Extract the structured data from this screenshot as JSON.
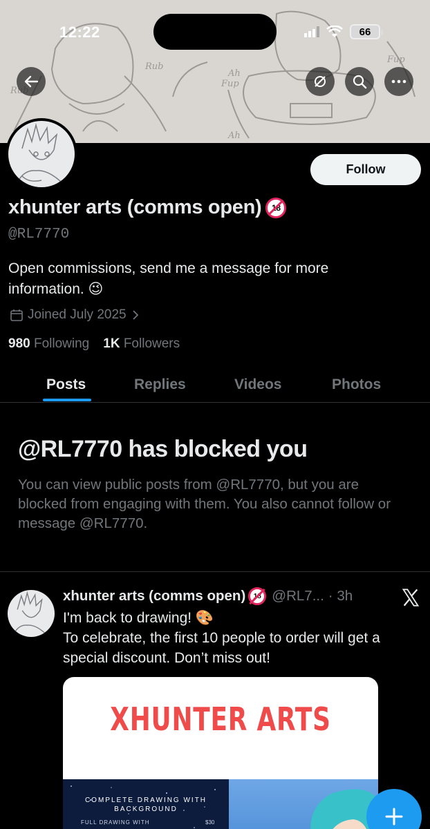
{
  "status_bar": {
    "time": "12:22",
    "battery": "66"
  },
  "profile": {
    "display_name": "xhunter arts (comms open)",
    "handle": "@RL7770",
    "bio": "Open commissions, send me a message for more information. 😉",
    "joined": "Joined July 2025",
    "following_count": "980",
    "following_label": "Following",
    "followers_count": "1K",
    "followers_label": "Followers",
    "follow_button": "Follow"
  },
  "tabs": [
    {
      "label": "Posts",
      "active": true
    },
    {
      "label": "Replies",
      "active": false
    },
    {
      "label": "Videos",
      "active": false
    },
    {
      "label": "Photos",
      "active": false
    }
  ],
  "blocked": {
    "title": "@RL7770 has blocked you",
    "message": "You can view public posts from @RL7770, but you are blocked from engaging with them. You also cannot follow or message @RL7770."
  },
  "post": {
    "author": "xhunter arts (comms open)",
    "handle_trunc": "@RL7...",
    "time": "· 3h",
    "line1": "I'm back to drawing! 🎨",
    "line2": "To celebrate, the first 10 people to order will get a special discount. Don’t miss out!",
    "media": {
      "title": "XHUNTER ARTS",
      "card_heading": "COMPLETE DRAWING WITH BACKGROUND",
      "card_item": "FULL DRAWING WITH",
      "card_price": "$30"
    }
  },
  "icons": {
    "back": "arrow-left-icon",
    "mute": "mute-icon",
    "search": "search-icon",
    "more": "more-icon",
    "calendar": "calendar-icon",
    "fab": "plus-icon"
  },
  "colors": {
    "accent": "#1d9bf0",
    "background": "#000000",
    "muted": "#71767b",
    "text": "#e7e9ea"
  }
}
